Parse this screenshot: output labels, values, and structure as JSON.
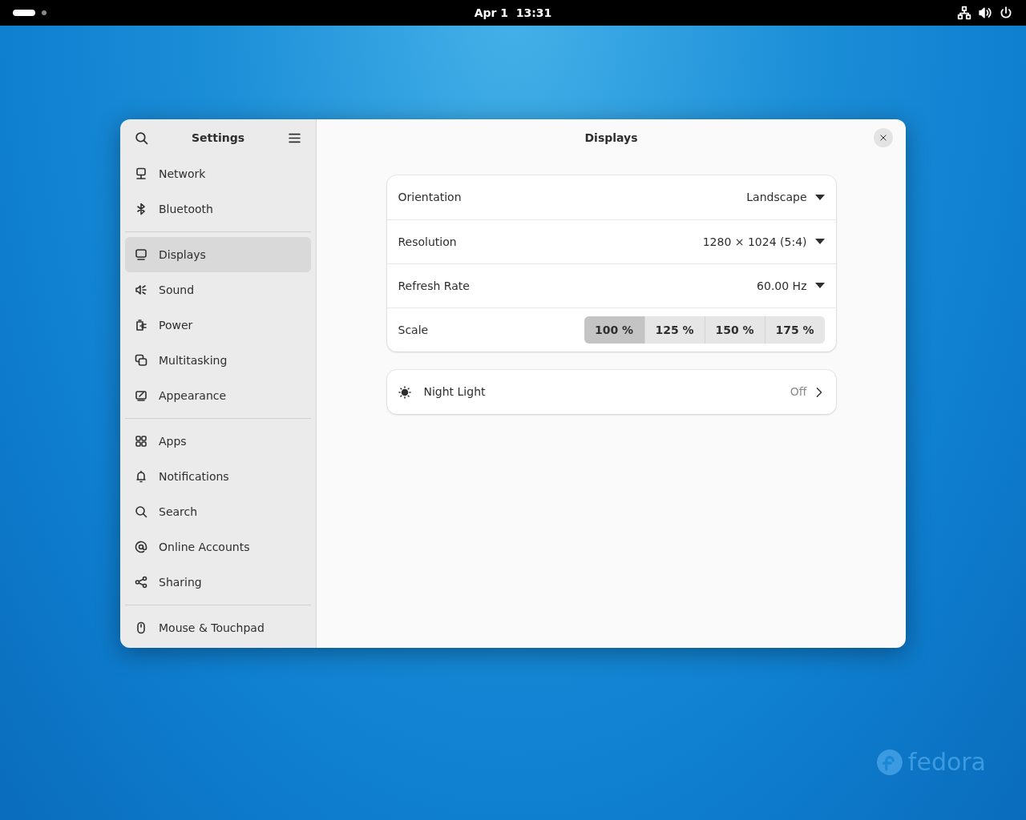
{
  "top_bar": {
    "workspaces": [
      {
        "selected": true
      },
      {
        "selected": false
      }
    ],
    "clock": "Apr 1  13:31"
  },
  "window": {
    "sidebar": {
      "title": "Settings",
      "groups": [
        [
          {
            "label": "Network",
            "selected": false
          },
          {
            "label": "Bluetooth",
            "selected": false
          }
        ],
        [
          {
            "label": "Displays",
            "selected": true
          },
          {
            "label": "Sound",
            "selected": false
          },
          {
            "label": "Power",
            "selected": false
          },
          {
            "label": "Multitasking",
            "selected": false
          },
          {
            "label": "Appearance",
            "selected": false
          }
        ],
        [
          {
            "label": "Apps",
            "selected": false
          },
          {
            "label": "Notifications",
            "selected": false
          },
          {
            "label": "Search",
            "selected": false
          },
          {
            "label": "Online Accounts",
            "selected": false
          },
          {
            "label": "Sharing",
            "selected": false
          }
        ],
        [
          {
            "label": "Mouse & Touchpad",
            "selected": false
          }
        ]
      ]
    },
    "title": "Displays",
    "settings": [
      {
        "kind": "dropdown",
        "label": "Orientation",
        "value": "Landscape"
      },
      {
        "kind": "dropdown",
        "label": "Resolution",
        "value": "1280 × 1024 (5:4)"
      },
      {
        "kind": "dropdown",
        "label": "Refresh Rate",
        "value": "60.00 Hz"
      },
      {
        "kind": "segmented",
        "label": "Scale",
        "options": [
          {
            "label": "100 %",
            "selected": true
          },
          {
            "label": "125 %",
            "selected": false
          },
          {
            "label": "150 %",
            "selected": false
          },
          {
            "label": "175 %",
            "selected": false
          }
        ]
      }
    ],
    "night_light": {
      "label": "Night Light",
      "value": "Off"
    }
  },
  "wallpaper_logo": "fedora"
}
